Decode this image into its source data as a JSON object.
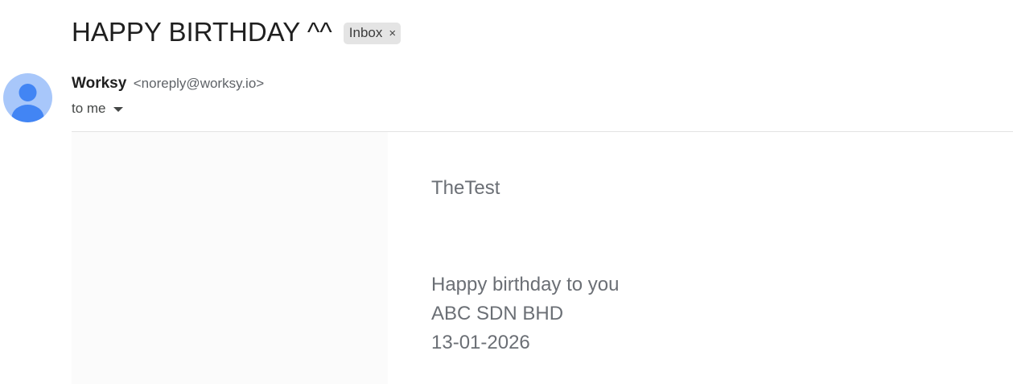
{
  "email": {
    "subject": "HAPPY BIRTHDAY ^^",
    "label": "Inbox",
    "label_remove_glyph": "×",
    "sender_name": "Worksy",
    "sender_email": "<noreply@worksy.io>",
    "recipient": "to me",
    "avatar_icon": "person-avatar-icon",
    "body": {
      "greeting": "TheTest",
      "lines": [
        "Happy birthday to you",
        "ABC SDN BHD",
        "13-01-2026"
      ]
    }
  },
  "colors": {
    "avatar_bg": "#a8c7fa",
    "avatar_figure": "#4285f4",
    "chip_bg": "#e4e4e4",
    "body_text": "#6b6f75"
  }
}
